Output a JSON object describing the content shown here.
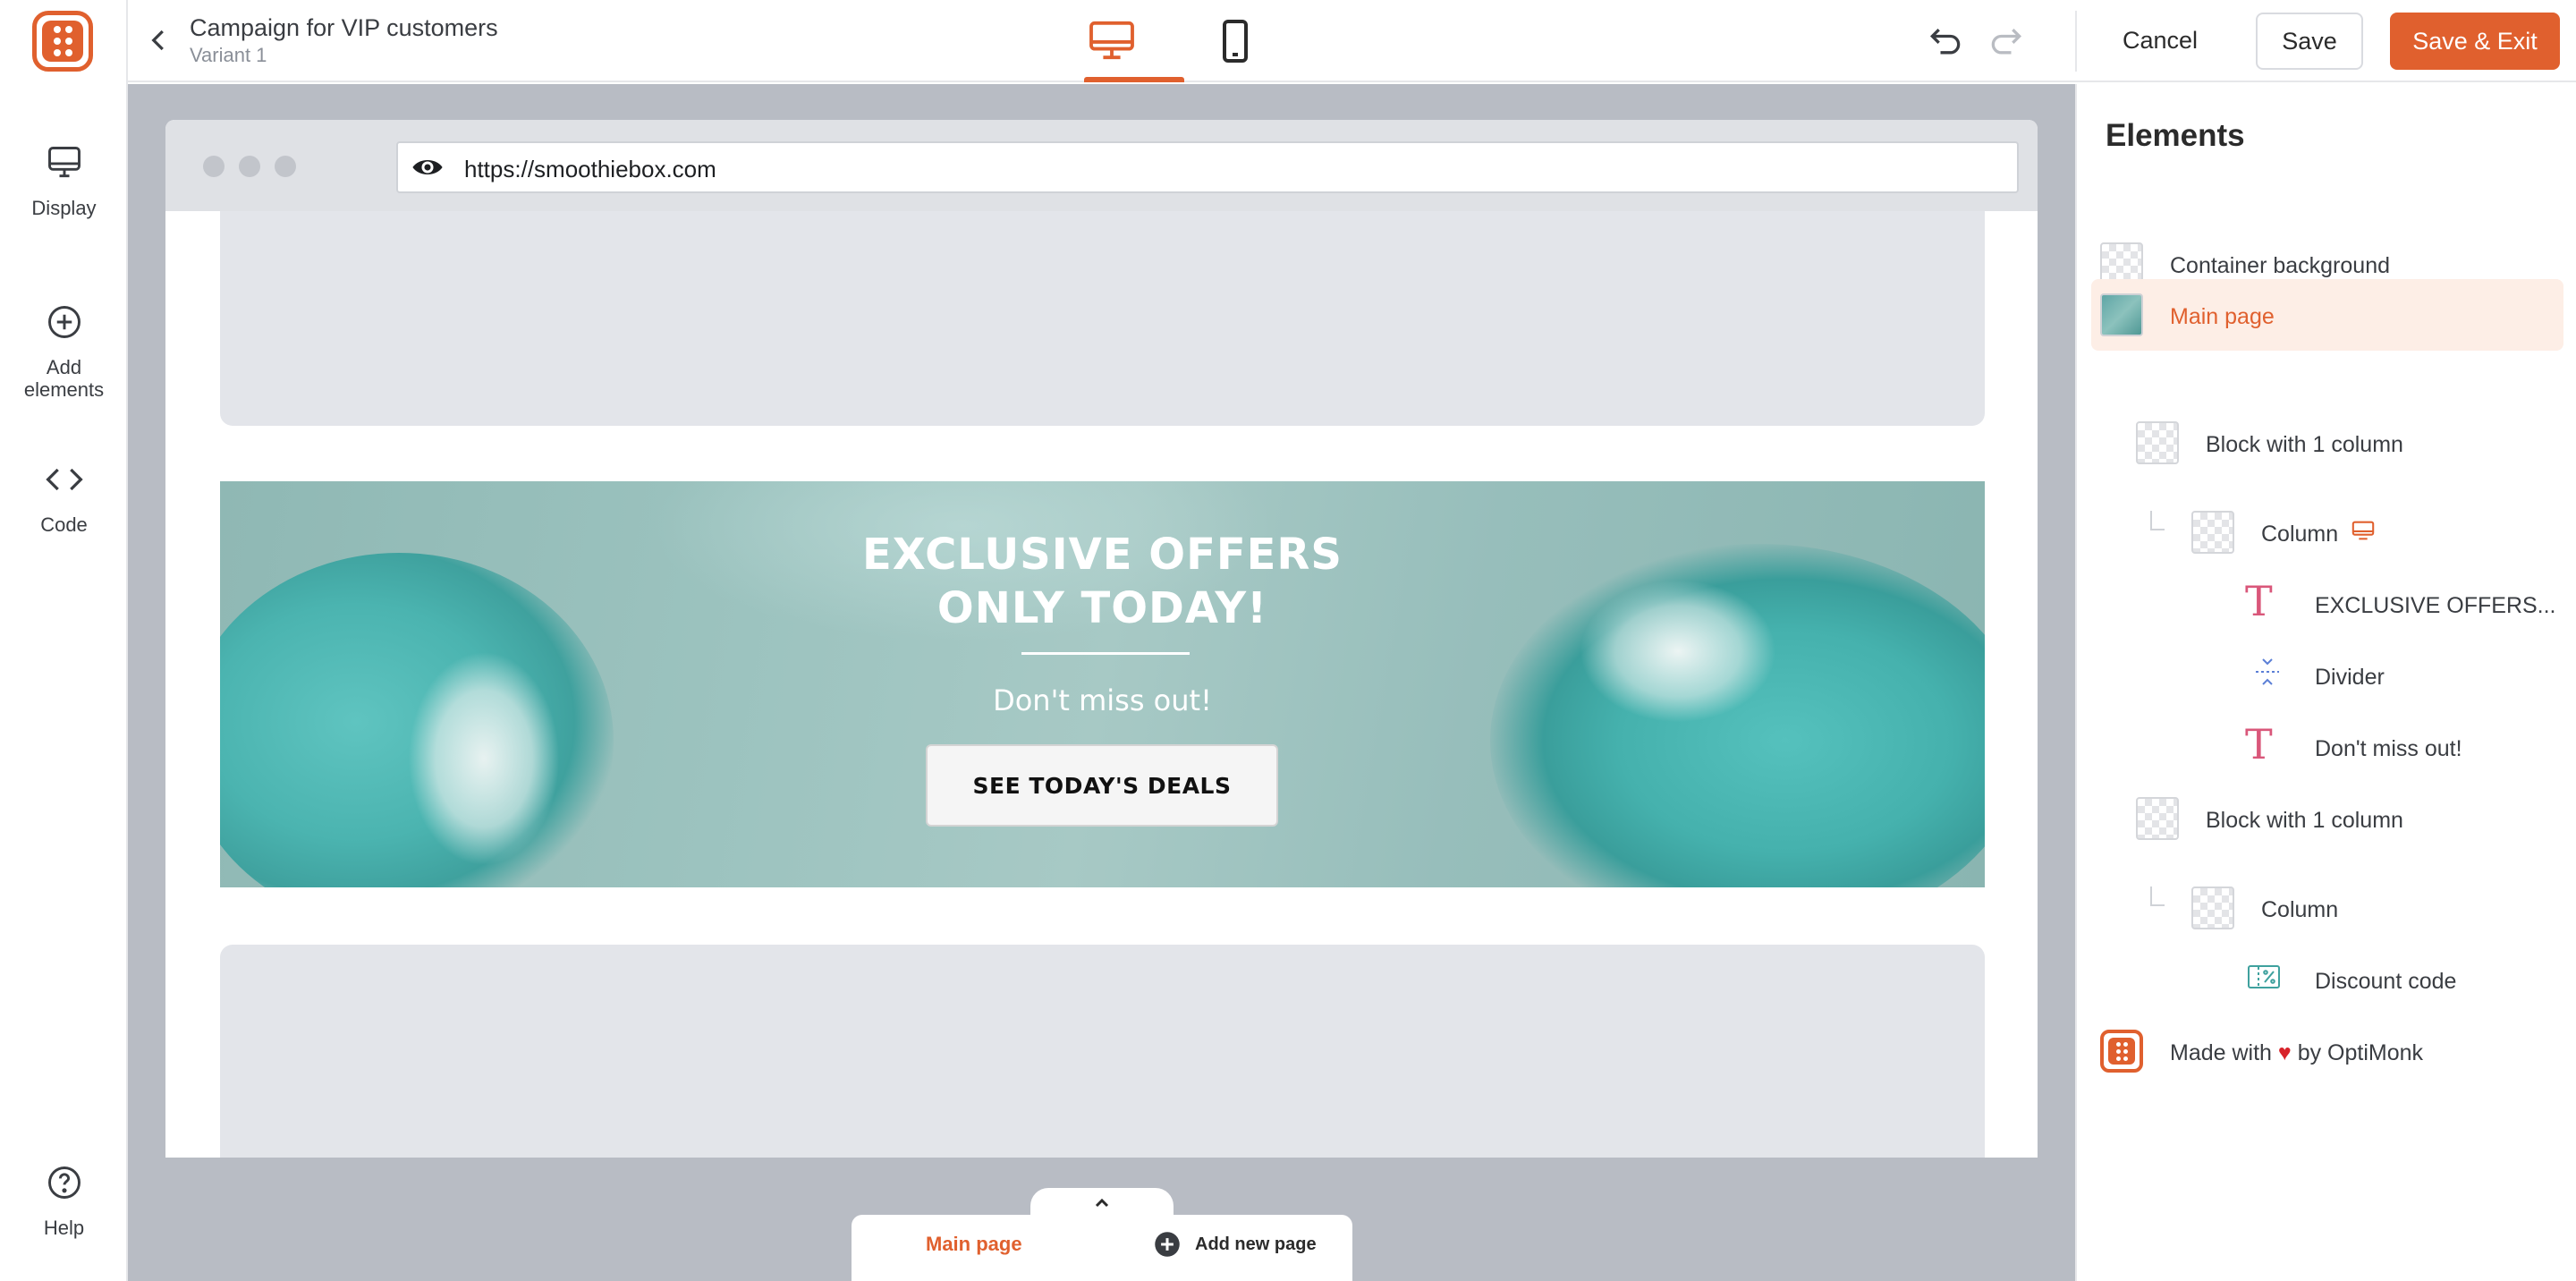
{
  "app": {
    "title": "Campaign for VIP customers",
    "variant": "Variant 1",
    "accent_color": "#e0602e"
  },
  "rail": {
    "display_label": "Display",
    "add_label_line1": "Add",
    "add_label_line2": "elements",
    "code_label": "Code",
    "help_label": "Help"
  },
  "toolbar": {
    "cancel_label": "Cancel",
    "save_label": "Save",
    "save_exit_label": "Save & Exit",
    "active_device": "desktop"
  },
  "preview": {
    "url": "https://smoothiebox.com",
    "banner_title_line1": "EXCLUSIVE OFFERS",
    "banner_title_line2": "ONLY TODAY!",
    "banner_subtitle": "Don't miss out!",
    "banner_button": "SEE TODAY'S DEALS"
  },
  "pages": {
    "main_page_tab": "Main page",
    "add_page_tab": "Add new page"
  },
  "elements_panel": {
    "title": "Elements",
    "items": [
      {
        "label": "Container background",
        "type": "container"
      },
      {
        "label": "Main page",
        "type": "page",
        "active": true
      },
      {
        "label": "Block with 1 column",
        "type": "block"
      },
      {
        "label": "Column",
        "type": "column",
        "badge": "desktop-icon"
      },
      {
        "label": "EXCLUSIVE OFFERS...",
        "type": "text"
      },
      {
        "label": "Divider",
        "type": "divider"
      },
      {
        "label": "Don't miss out!",
        "type": "text"
      },
      {
        "label": "Block with 1 column",
        "type": "block"
      },
      {
        "label": "Column",
        "type": "column"
      },
      {
        "label": "Discount code",
        "type": "coupon"
      },
      {
        "label_pre": "Made with",
        "label_post": "by OptiMonk",
        "type": "brand"
      }
    ]
  }
}
